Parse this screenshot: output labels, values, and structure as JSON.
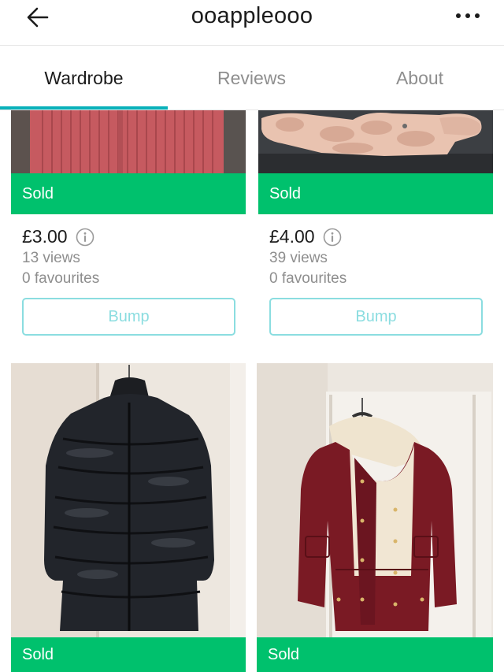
{
  "header": {
    "title": "ooappleooo",
    "back_icon": "arrow-left-icon",
    "more_icon": "more-horizontal-icon"
  },
  "tabs": [
    {
      "label": "Wardrobe",
      "active": true
    },
    {
      "label": "Reviews",
      "active": false
    },
    {
      "label": "About",
      "active": false
    }
  ],
  "colors": {
    "accent": "#09b1ba",
    "sold": "#00c16d",
    "bump_border": "#8bdde0",
    "muted_text": "#8e8e8e"
  },
  "items": [
    {
      "status": "Sold",
      "price": "£3.00",
      "views": "13 views",
      "favourites": "0 favourites",
      "bump_label": "Bump",
      "photo": "pink knit cardigan"
    },
    {
      "status": "Sold",
      "price": "£4.00",
      "views": "39 views",
      "favourites": "0 favourites",
      "bump_label": "Bump",
      "photo": "pink faux fur jacket"
    },
    {
      "status": "Sold",
      "photo": "black long puffer coat"
    },
    {
      "status": "Sold",
      "photo": "burgundy parka with sherpa hood"
    }
  ]
}
